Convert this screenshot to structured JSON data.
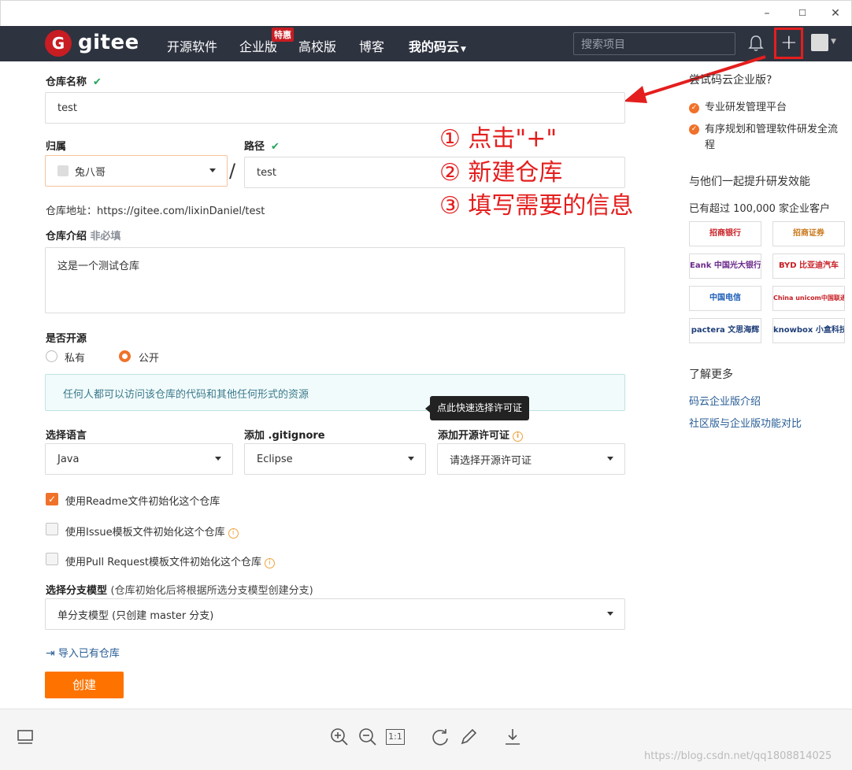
{
  "window": {
    "minimize": "–",
    "maximize": "☐",
    "close": "✕"
  },
  "nav": {
    "logo_letter": "G",
    "logo_text": "gitee",
    "links": [
      "开源软件",
      "企业版",
      "高校版",
      "博客",
      "我的码云"
    ],
    "badge": "特惠",
    "search_placeholder": "搜索项目",
    "plus": "+"
  },
  "form": {
    "repo_name_label": "仓库名称",
    "repo_name_value": "test",
    "owner_label": "归属",
    "owner_value": "兔八哥",
    "path_label": "路径",
    "path_value": "test",
    "slash": "/",
    "repo_url": "仓库地址：https://gitee.com/lixinDaniel/test",
    "desc_label": "仓库介绍",
    "desc_optional": "非必填",
    "desc_value": "这是一个测试仓库",
    "open_label": "是否开源",
    "radio_private": "私有",
    "radio_public": "公开",
    "notice": "任何人都可以访问该仓库的代码和其他任何形式的资源",
    "tooltip": "点此快速选择许可证",
    "lang_label": "选择语言",
    "lang_value": "Java",
    "gitignore_label": "添加 .gitignore",
    "gitignore_value": "Eclipse",
    "license_label": "添加开源许可证",
    "license_value": "请选择开源许可证",
    "cb_readme": "使用Readme文件初始化这个仓库",
    "cb_issue": "使用Issue模板文件初始化这个仓库",
    "cb_pr": "使用Pull Request模板文件初始化这个仓库",
    "branch_label": "选择分支模型",
    "branch_hint": "(仓库初始化后将根据所选分支模型创建分支)",
    "branch_value": "单分支模型 (只创建 master 分支)",
    "import_link": "导入已有仓库",
    "create_button": "创建"
  },
  "annotations": [
    "① 点击\"+\"",
    "② 新建仓库",
    "③ 填写需要的信息"
  ],
  "annotation_color": "#e41e1e",
  "sidebar": {
    "try_title": "尝试码云企业版?",
    "feature_1": "专业研发管理平台",
    "feature_2": "有序规划和管理软件研发全流程",
    "together_title": "与他们一起提升研发效能",
    "customers": "已有超过 100,000 家企业客户",
    "logos": [
      "招商银行",
      "招商证券",
      "Eank 中国光大银行",
      "BYD 比亚迪汽车",
      "中国电信",
      "China unicom中国联通",
      "pactera 文思海辉",
      "knowbox 小盒科技"
    ],
    "learn_more": "了解更多",
    "link_1": "码云企业版介绍",
    "link_2": "社区版与企业版功能对比"
  },
  "toolbar": {
    "icons": [
      "thumbnail-icon",
      "zoom-in-icon",
      "zoom-out-icon",
      "actual-size-icon",
      "rotate-icon",
      "edit-icon",
      "download-icon"
    ],
    "actual_size": "1:1",
    "watermark": "https://blog.csdn.net/qq1808814025"
  },
  "colors": {
    "accent": "#fe7300",
    "nav_bg": "#2e3340",
    "brand_red": "#c71d23"
  }
}
